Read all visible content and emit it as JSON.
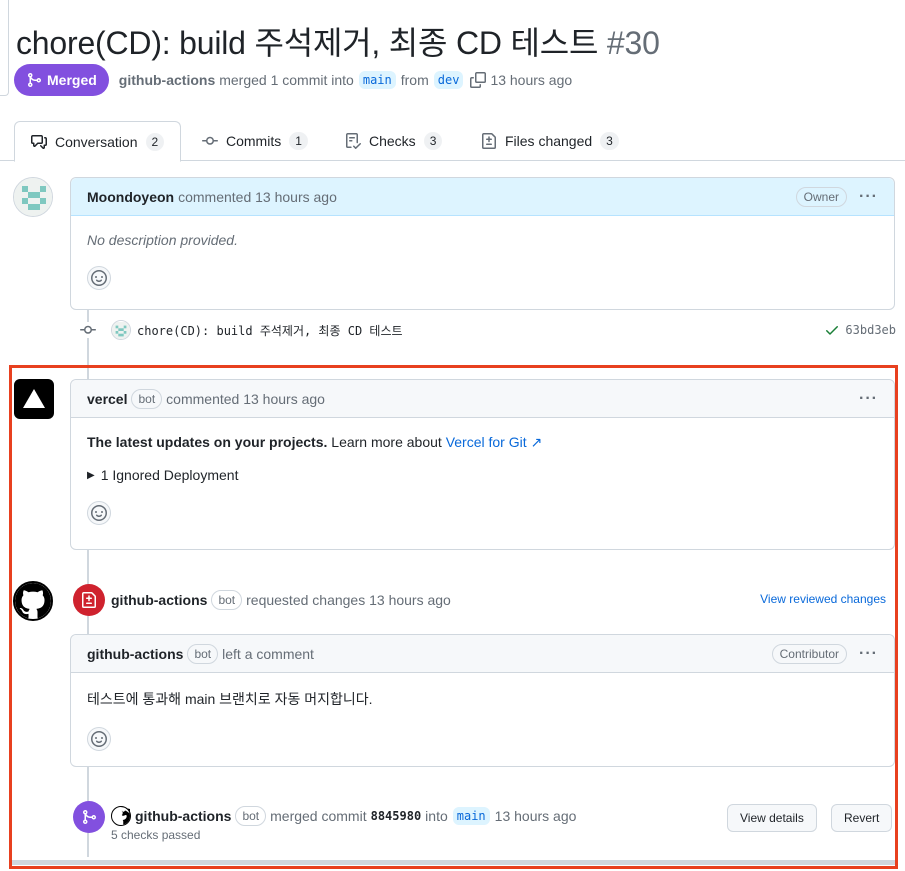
{
  "pr": {
    "title": "chore(CD): build 주석제거, 최종 CD 테스트",
    "number": "#30",
    "state": "Merged",
    "author": "github-actions",
    "merged_text": "merged 1 commit into",
    "base_branch": "main",
    "from_text": "from",
    "head_branch": "dev",
    "time": "13 hours ago"
  },
  "tabs": [
    {
      "label": "Conversation",
      "count": "2",
      "icon": "comment-discussion-icon"
    },
    {
      "label": "Commits",
      "count": "1",
      "icon": "git-commit-icon"
    },
    {
      "label": "Checks",
      "count": "3",
      "icon": "checklist-icon"
    },
    {
      "label": "Files changed",
      "count": "3",
      "icon": "file-diff-icon"
    }
  ],
  "comment1": {
    "author": "Moondoyeon",
    "action": "commented 13 hours ago",
    "role": "Owner",
    "body": "No description provided."
  },
  "commit": {
    "message": "chore(CD): build 주석제거, 최종 CD 테스트",
    "sha": "63bd3eb"
  },
  "comment2": {
    "author": "vercel",
    "bot": "bot",
    "action": "commented 13 hours ago",
    "body_bold": "The latest updates on your projects.",
    "body_text": " Learn more about ",
    "body_link": "Vercel for Git ↗",
    "details": "1 Ignored Deployment"
  },
  "review": {
    "author": "github-actions",
    "bot": "bot",
    "action": "requested changes 13 hours ago",
    "link": "View reviewed changes"
  },
  "comment3": {
    "author": "github-actions",
    "bot": "bot",
    "action": "left a comment",
    "role": "Contributor",
    "body": "테스트에 통과해 main 브랜치로 자동 머지합니다."
  },
  "merge_event": {
    "author": "github-actions",
    "bot": "bot",
    "action": "merged commit",
    "sha": "8845980",
    "into": "into",
    "branch": "main",
    "time": "13 hours ago",
    "checks": "5 checks passed",
    "view_details": "View details",
    "revert": "Revert"
  },
  "colors": {
    "merged_purple": "#8250df",
    "changes_red": "#cf222e",
    "link_blue": "#0969da",
    "highlight_red": "#e8401f"
  }
}
